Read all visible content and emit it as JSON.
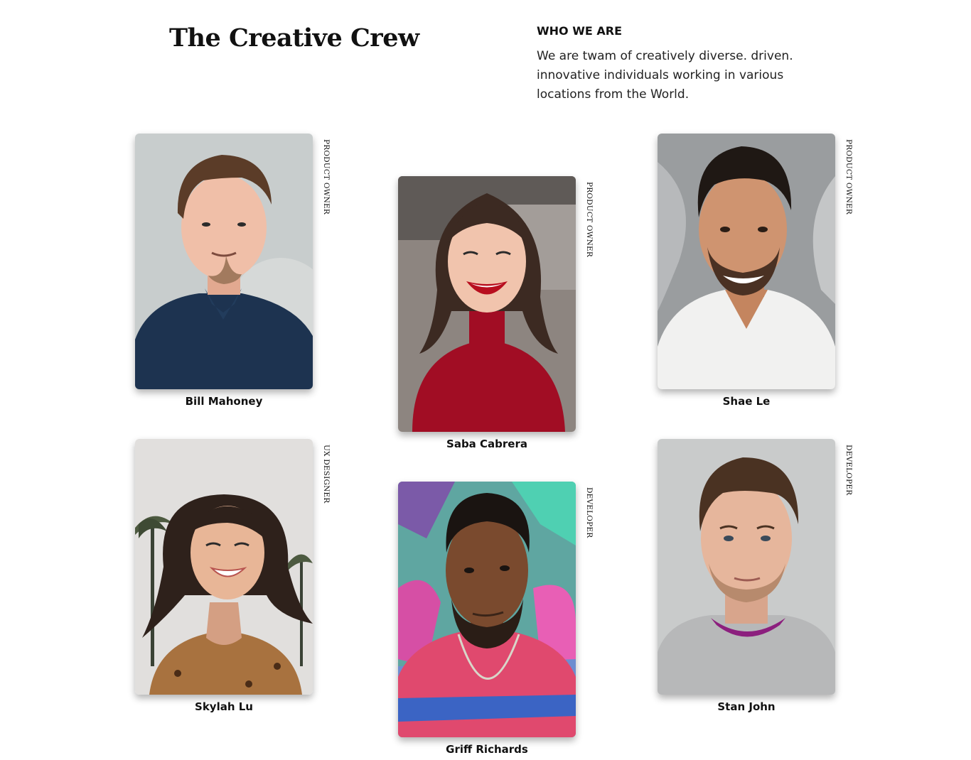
{
  "header": {
    "title": "The Creative Crew"
  },
  "about": {
    "heading": "WHO WE ARE",
    "text": "We are twam of creatively diverse. driven. innovative individuals working in various locations from the World."
  },
  "team": [
    {
      "name": "Bill Mahoney",
      "role": "PRODUCT OWNER"
    },
    {
      "name": "Saba Cabrera",
      "role": "PRODUCT OWNER"
    },
    {
      "name": "Shae Le",
      "role": "PRODUCT OWNER"
    },
    {
      "name": "Skylah Lu",
      "role": "UX DESIGNER"
    },
    {
      "name": "Griff Richards",
      "role": "DEVELOPER"
    },
    {
      "name": "Stan John",
      "role": "DEVELOPER"
    }
  ]
}
